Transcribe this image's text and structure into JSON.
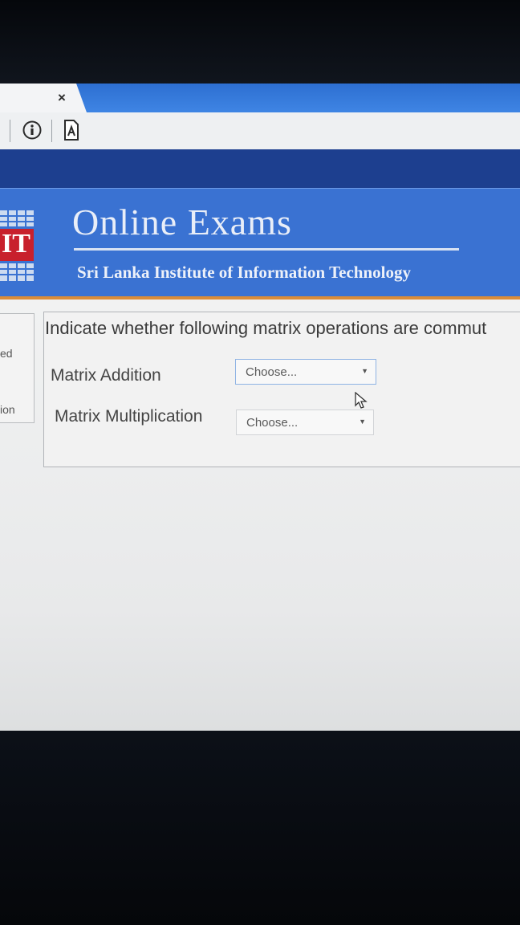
{
  "browser": {
    "tab_close": "×",
    "info_icon": "info-icon",
    "site_icon": "document-icon"
  },
  "header": {
    "logo_text": "IT",
    "title": "Online Exams",
    "subtitle": "Sri Lanka Institute of Information Technology"
  },
  "side_panel": {
    "items": [
      "ed",
      "ion"
    ]
  },
  "question": {
    "text": "Indicate whether following matrix operations are commut",
    "rows": [
      {
        "label": "Matrix Addition",
        "selected": "Choose..."
      },
      {
        "label": "Matrix Multiplication",
        "selected": "Choose..."
      }
    ]
  },
  "colors": {
    "tabstrip": "#3f85e4",
    "banner": "#3a72d2",
    "accent_underline": "#d98c3a"
  }
}
